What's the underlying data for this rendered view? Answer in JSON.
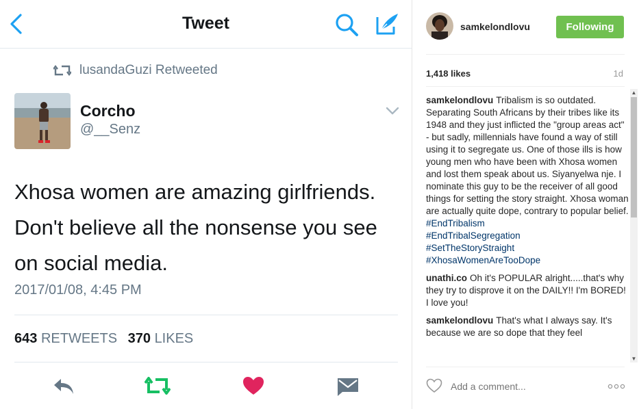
{
  "twitter": {
    "title": "Tweet",
    "retweeted_by": "lusandaGuzi Retweeted",
    "author_name": "Corcho",
    "author_handle": "@__Senz",
    "text": "Xhosa women are amazing girlfriends. Don't believe all the nonsense you see on social media.",
    "timestamp": "2017/01/08, 4:45 PM",
    "retweets_count": "643",
    "retweets_label": "RETWEETS",
    "likes_count": "370",
    "likes_label": "LIKES",
    "colors": {
      "accent": "#1da1f2",
      "retweet_green": "#17bf63",
      "like_red": "#e0245e",
      "muted": "#657786"
    },
    "icons": [
      "back-chevron-icon",
      "search-icon",
      "compose-icon",
      "retweet-icon",
      "chevron-down-icon",
      "reply-icon",
      "heart-icon",
      "message-icon"
    ]
  },
  "instagram": {
    "username": "samkelondlovu",
    "follow_button": "Following",
    "likes": "1,418 likes",
    "time_ago": "1d",
    "comments": [
      {
        "user": "samkelondlovu",
        "text": "Tribalism is so outdated. Separating South Africans by their tribes like its 1948 and they just inflicted the \"group areas act\" - but sadly, millennials have found a way of still using it to segregate us. One of those ills is how young men who have been with Xhosa women and lost them speak about us. Siyanyelwa nje. I nominate this guy to be the receiver of all good things for setting the story straight. Xhosa woman are actually quite dope, contrary to popular belief.",
        "tags": [
          "#EndTribalism",
          "#EndTribalSegregation",
          "#SetTheStoryStraight",
          "#XhosaWomenAreTooDope"
        ]
      },
      {
        "user": "unathi.co",
        "text": "Oh it's POPULAR alright.....that's why they try to disprove it on the DAILY!! I'm BORED! I love you!"
      },
      {
        "user": "samkelondlovu",
        "text": "That's what I always say. It's because we are so dope that they feel"
      }
    ],
    "add_comment_placeholder": "Add a comment...",
    "colors": {
      "follow_green": "#70c050",
      "hashtag_blue": "#003569"
    },
    "icons": [
      "heart-outline-icon",
      "more-options-icon"
    ]
  }
}
